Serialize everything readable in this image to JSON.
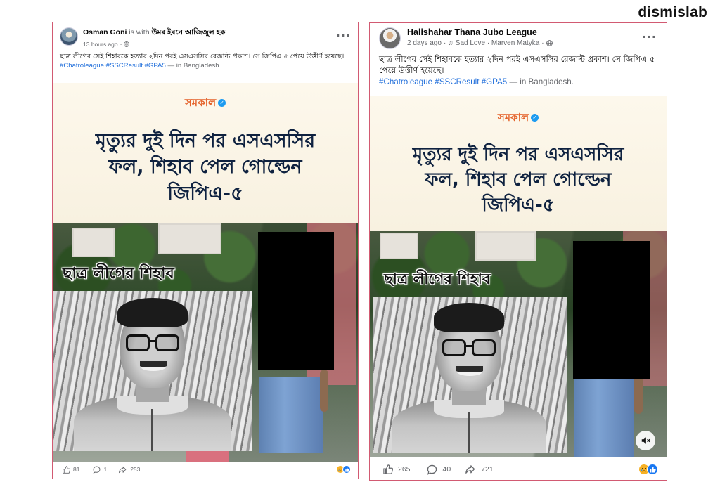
{
  "brand": "dismislab",
  "posts": [
    {
      "author": "Osman Goni",
      "with_prefix": "is with",
      "with_name": "উমর ইবনে আজিজুল হক",
      "time": "13 hours ago",
      "privacy_icon": "globe-icon",
      "caption": "ছাত্র লীগের সেই শিহাবকে হত্যার ২দিন পরই এসএসসির রেজাল্ট প্রকাশ। সে জিপিএ ৫ পেয়ে উত্তীর্ণ হয়েছে।",
      "hashtags": [
        "#Chatroleague",
        "#SSCResult",
        "#GPA5"
      ],
      "location_text": "— in Bangladesh.",
      "image": {
        "newspaper_logo": "সমকাল",
        "headline": [
          "মৃত্যুর দুই দিন পর এসএসসির",
          "ফল, শিহাব পেল গোল্ডেন",
          "জিপিএ-৫"
        ],
        "photo_label": "ছাত্র লীগের শিহাব"
      },
      "likes": "81",
      "comments": "1",
      "shares": "253"
    },
    {
      "author": "Halishahar Thana Jubo League",
      "time": "2 days ago",
      "music": "Sad Love · Marven Matyka",
      "privacy_icon": "globe-icon",
      "caption": "ছাত্র লীগের সেই শিহাবকে হত্যার ২দিন পরই এসএসসির রেজাল্ট প্রকাশ। সে জিপিএ ৫ পেয়ে উত্তীর্ণ হয়েছে।",
      "hashtags": [
        "#Chatroleague",
        "#SSCResult",
        "#GPA5"
      ],
      "location_text": "— in Bangladesh.",
      "image": {
        "newspaper_logo": "সমকাল",
        "headline": [
          "মৃত্যুর দুই দিন পর এসএসসির",
          "ফল, শিহাব পেল গোল্ডেন",
          "জিপিএ-৫"
        ],
        "photo_label": "ছাত্র লীগের শিহাব"
      },
      "likes": "265",
      "comments": "40",
      "shares": "721"
    }
  ],
  "colors": {
    "frame": "#d25a72",
    "link": "#216fdb",
    "meta": "#65676b",
    "logo": "#e4622a",
    "headline": "#0f2240"
  }
}
